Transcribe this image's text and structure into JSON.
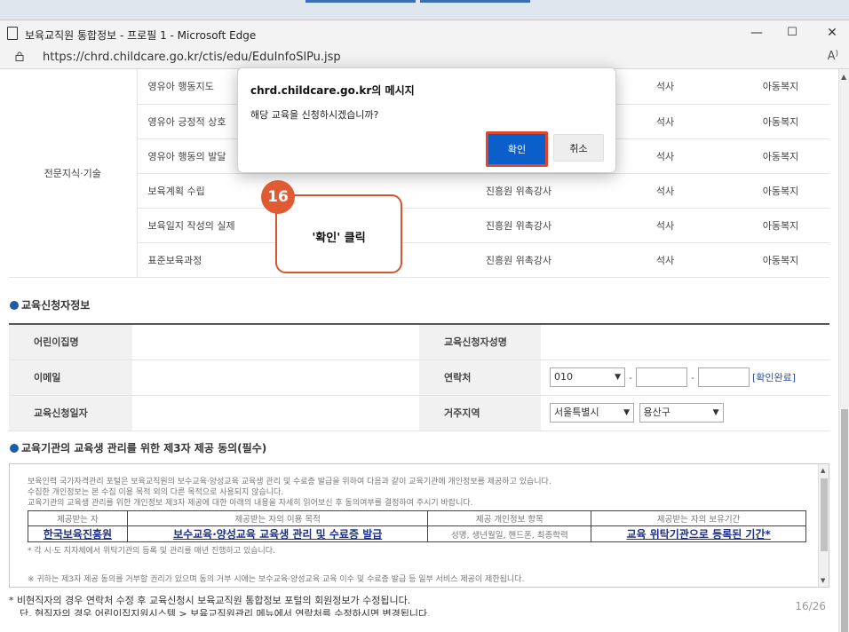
{
  "window": {
    "title": "보육교직원 통합정보 - 프로필 1 - Microsoft Edge",
    "url": "https://chrd.childcare.go.kr/ctis/edu/EduInfoSlPu.jsp",
    "reader_label": "A)",
    "minimize_label": "—",
    "maximize_label": "☐",
    "close_label": "✕"
  },
  "course_table": {
    "category": "전문지식·기술",
    "rows": [
      {
        "name": "영유아 행동지도",
        "lecturer": "",
        "degree": "석사",
        "major": "아동복지"
      },
      {
        "name": "영유아 긍정적 상호",
        "lecturer": "",
        "degree": "석사",
        "major": "아동복지"
      },
      {
        "name": "영유아 행동의 발달",
        "lecturer": "",
        "degree": "석사",
        "major": "아동복지"
      },
      {
        "name": "보육계획 수립",
        "lecturer": "진흥원 위촉강사",
        "degree": "석사",
        "major": "아동복지"
      },
      {
        "name": "보육일지 작성의 실제",
        "lecturer": "진흥원 위촉강사",
        "degree": "석사",
        "major": "아동복지"
      },
      {
        "name": "표준보육과정",
        "lecturer": "진흥원 위촉강사",
        "degree": "석사",
        "major": "아동복지"
      }
    ]
  },
  "applicant_section": {
    "title": "교육신청자정보",
    "daycare_label": "어린이집명",
    "applicant_name_label": "교육신청자성명",
    "email_label": "이메일",
    "contact_label": "연락처",
    "phone_prefix": "010",
    "verify_label": "[확인완료]",
    "date_label": "교육신청일자",
    "region_label": "거주지역",
    "region_city": "서울특별시",
    "region_district": "용산구"
  },
  "consent_section": {
    "title": "교육기관의 교육생 관리를 위한 제3자 제공 동의(필수)",
    "line1": "보육인력 국가자격관리 포털은 보육교직원의 보수교육·양성교육 교육생 관리 및 수료증 발급을 위하여 다음과 같이 교육기관에 개인정보를 제공하고 있습니다.",
    "line2": "수집한 개인정보는 본 수집 이용 목적 외의 다른 목적으로 사용되지 않습니다.",
    "line3": "교육기관의 교육생 관리를 위한 개인정보 제3자 제공에 대한 아래의 내용을 자세히 읽어보신 후 동의여부를 결정하여 주시기 바랍니다.",
    "headers": [
      "제공받는 자",
      "제공받는 자의 이용 목적",
      "제공 개인정보 항목",
      "제공받는 자의 보유기간"
    ],
    "values": [
      "한국보육진흥원",
      "보수교육·양성교육 교육생 관리 및 수료증 발급",
      "성명, 생년월일, 핸드폰, 최종학력",
      "교육 위탁기관으로 등록된 기간*"
    ],
    "note1": "* 각 시·도 지자체에서 위탁기관의 등록 및 관리를 매년 진행하고 있습니다.",
    "note2": "※ 귀하는 제3자 제공 동의를 거부할 권리가 있으며 동의 거부 시에는 보수교육·양성교육 교육 이수 및 수료증 발급 등 일부 서비스 제공이 제한됩니다."
  },
  "footer": {
    "note1": "* 비현직자의 경우 연락처 수정 후 교육신청시 보육교직원 통합정보 포털의 회원정보가 수정됩니다.",
    "note2": "단, 현직자의 경우 어린이집지원시스템 > 보육교직원관리 메뉴에서 연락처를 수정하시면 변경됩니다.",
    "page": "16/26"
  },
  "dialog": {
    "title": "chrd.childcare.go.kr의 메시지",
    "message": "해당 교육을 신청하시겠습니까?",
    "ok_label": "확인",
    "cancel_label": "취소"
  },
  "callout": {
    "step": "16",
    "text": "'확인' 클릭"
  },
  "colors": {
    "ok_button": "#0b5fcb",
    "highlight": "#e0462a",
    "section_bullet": "#1d5ca8"
  }
}
